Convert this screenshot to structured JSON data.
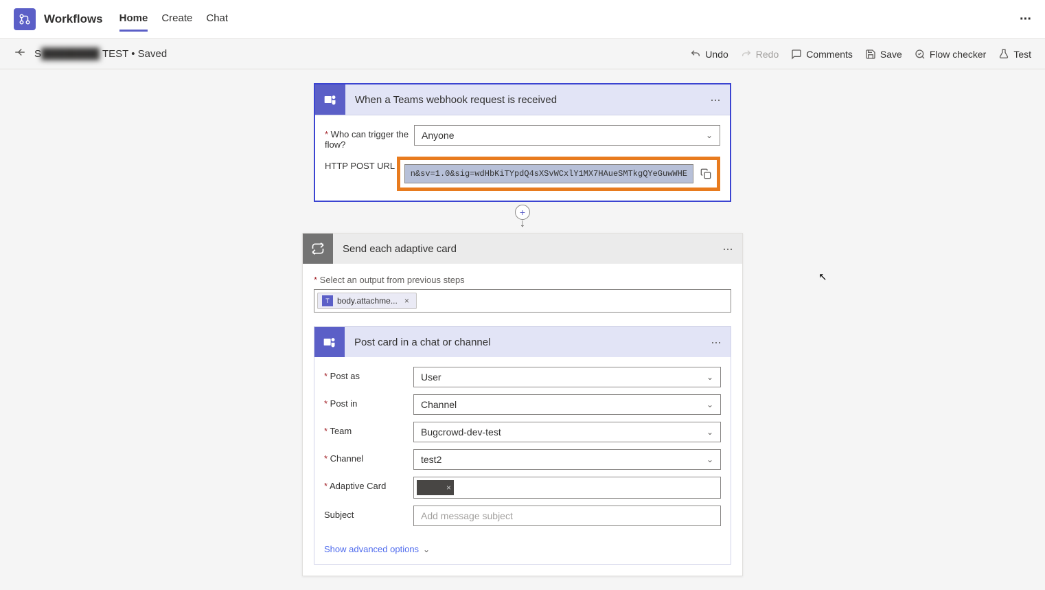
{
  "app": {
    "title": "Workflows"
  },
  "tabs": {
    "home": "Home",
    "create": "Create",
    "chat": "Chat"
  },
  "subbar": {
    "crumb_prefix": "S",
    "crumb_suffix": "TEST",
    "status": "Saved"
  },
  "actions": {
    "undo": "Undo",
    "redo": "Redo",
    "comments": "Comments",
    "save": "Save",
    "flow_checker": "Flow checker",
    "test": "Test"
  },
  "trigger": {
    "title": "When a Teams webhook request is received",
    "who_label": "Who can trigger the flow?",
    "who_value": "Anyone",
    "url_label": "HTTP POST URL",
    "url_value": "n&sv=1.0&sig=wdHbKiTYpdQ4sXSvWCxlY1MX7HAueSMTkgQYeGuwWHE"
  },
  "foreach": {
    "title": "Send each adaptive card",
    "select_label": "Select an output from previous steps",
    "token": "body.attachme..."
  },
  "post": {
    "title": "Post card in a chat or channel",
    "post_as_label": "Post as",
    "post_as_value": "User",
    "post_in_label": "Post in",
    "post_in_value": "Channel",
    "team_label": "Team",
    "team_value": "Bugcrowd-dev-test",
    "channel_label": "Channel",
    "channel_value": "test2",
    "adaptive_label": "Adaptive Card",
    "subject_label": "Subject",
    "subject_placeholder": "Add message subject"
  },
  "advanced": "Show advanced options"
}
